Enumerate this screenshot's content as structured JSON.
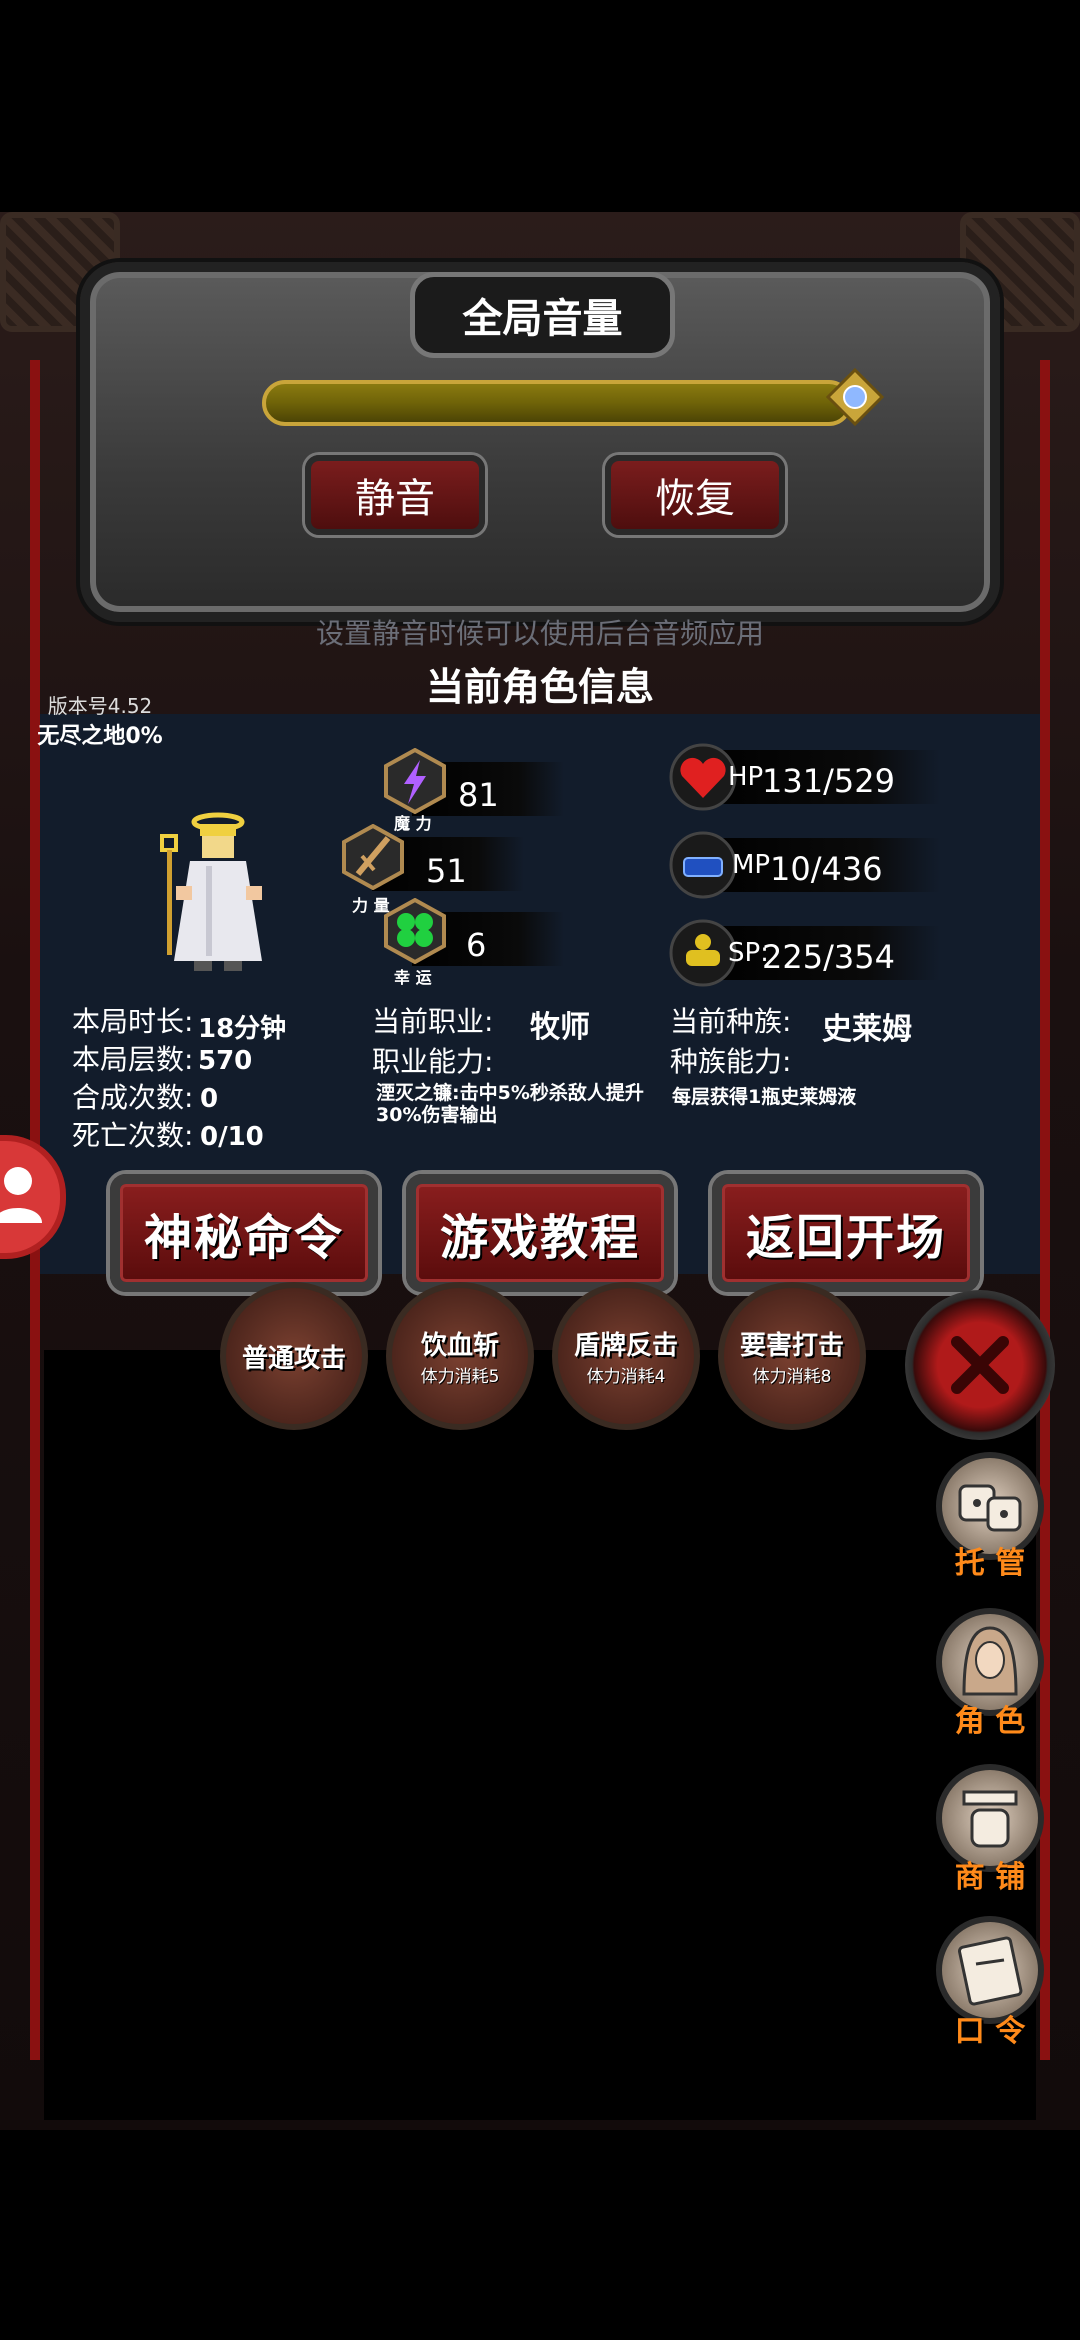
{
  "volume": {
    "title": "全局音量",
    "level": 1.0,
    "mute_label": "静音",
    "restore_label": "恢复",
    "hint": "设置静音时候可以使用后台音频应用"
  },
  "character": {
    "title": "当前角色信息",
    "version": "版本号4.52",
    "endless": "无尽之地0%",
    "stats": {
      "magic": {
        "label": "魔 力",
        "value": "81"
      },
      "strength": {
        "label": "力 量",
        "value": "51"
      },
      "luck": {
        "label": "幸 运",
        "value": "6"
      }
    },
    "vitals": {
      "hp": {
        "label": "HP",
        "value": "131/529"
      },
      "mp": {
        "label": "MP",
        "value": "10/436"
      },
      "sp": {
        "label": "SP:",
        "value": "225/354"
      }
    },
    "session": {
      "duration_label": "本局时长:",
      "duration": "18分钟",
      "floors_label": "本局层数:",
      "floors": "570",
      "synth_label": "合成次数:",
      "synth": "0",
      "deaths_label": "死亡次数:",
      "deaths": "0/10"
    },
    "job": {
      "label": "当前职业:",
      "value": "牧师",
      "ability_label": "职业能力:",
      "ability": "湮灭之镰:击中5%秒杀敌人提升30%伤害输出"
    },
    "race": {
      "label": "当前种族:",
      "value": "史莱姆",
      "ability_label": "种族能力:",
      "ability": "每层获得1瓶史莱姆液"
    }
  },
  "actions": {
    "secret": "神秘命令",
    "tutorial": "游戏教程",
    "back": "返回开场"
  },
  "skills": [
    {
      "name": "普通攻击",
      "cost": ""
    },
    {
      "name": "饮血斩",
      "cost": "体力消耗5"
    },
    {
      "name": "盾牌反击",
      "cost": "体力消耗4"
    },
    {
      "name": "要害打击",
      "cost": "体力消耗8"
    }
  ],
  "side_menu": {
    "auto": "托 管",
    "role": "角 色",
    "shop": "商 铺",
    "code": "口 令"
  },
  "colors": {
    "accent_orange": "#ff8a1a",
    "button_red": "#8a1e1e",
    "panel_bg": "#121c2b",
    "slider_gold": "#8a7a10"
  },
  "icons": [
    "lightning-icon",
    "sword-icon",
    "clover-icon",
    "heart-icon",
    "mp-icon",
    "sp-icon",
    "dice-icon",
    "hooded-figure-icon",
    "shop-icon",
    "scroll-icon",
    "close-icon",
    "user-icon"
  ]
}
